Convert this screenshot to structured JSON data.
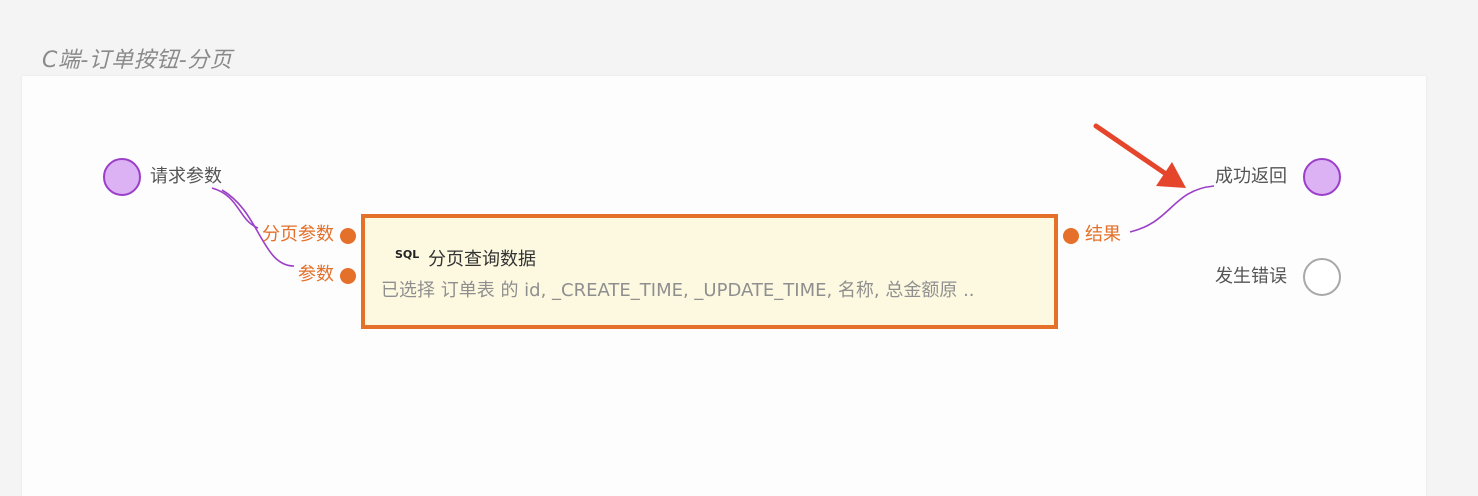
{
  "page": {
    "title": "C端-订单按钮-分页"
  },
  "flow": {
    "input": {
      "label": "请求参数"
    },
    "node": {
      "badge": "SQL",
      "title": "分页查询数据",
      "description": "已选择 订单表 的 id, _CREATE_TIME, _UPDATE_TIME, 名称, 总金额原 ..",
      "inputs": [
        "分页参数",
        "参数"
      ],
      "output": "结果"
    },
    "outputs": [
      {
        "label": "成功返回"
      },
      {
        "label": "发生错误"
      }
    ]
  },
  "colors": {
    "accent": "#e4702a",
    "wire": "#9b3fc8",
    "port_fill": "#dcb2f4",
    "arrow": "#e5452b",
    "node_bg": "#fdf9e1"
  }
}
